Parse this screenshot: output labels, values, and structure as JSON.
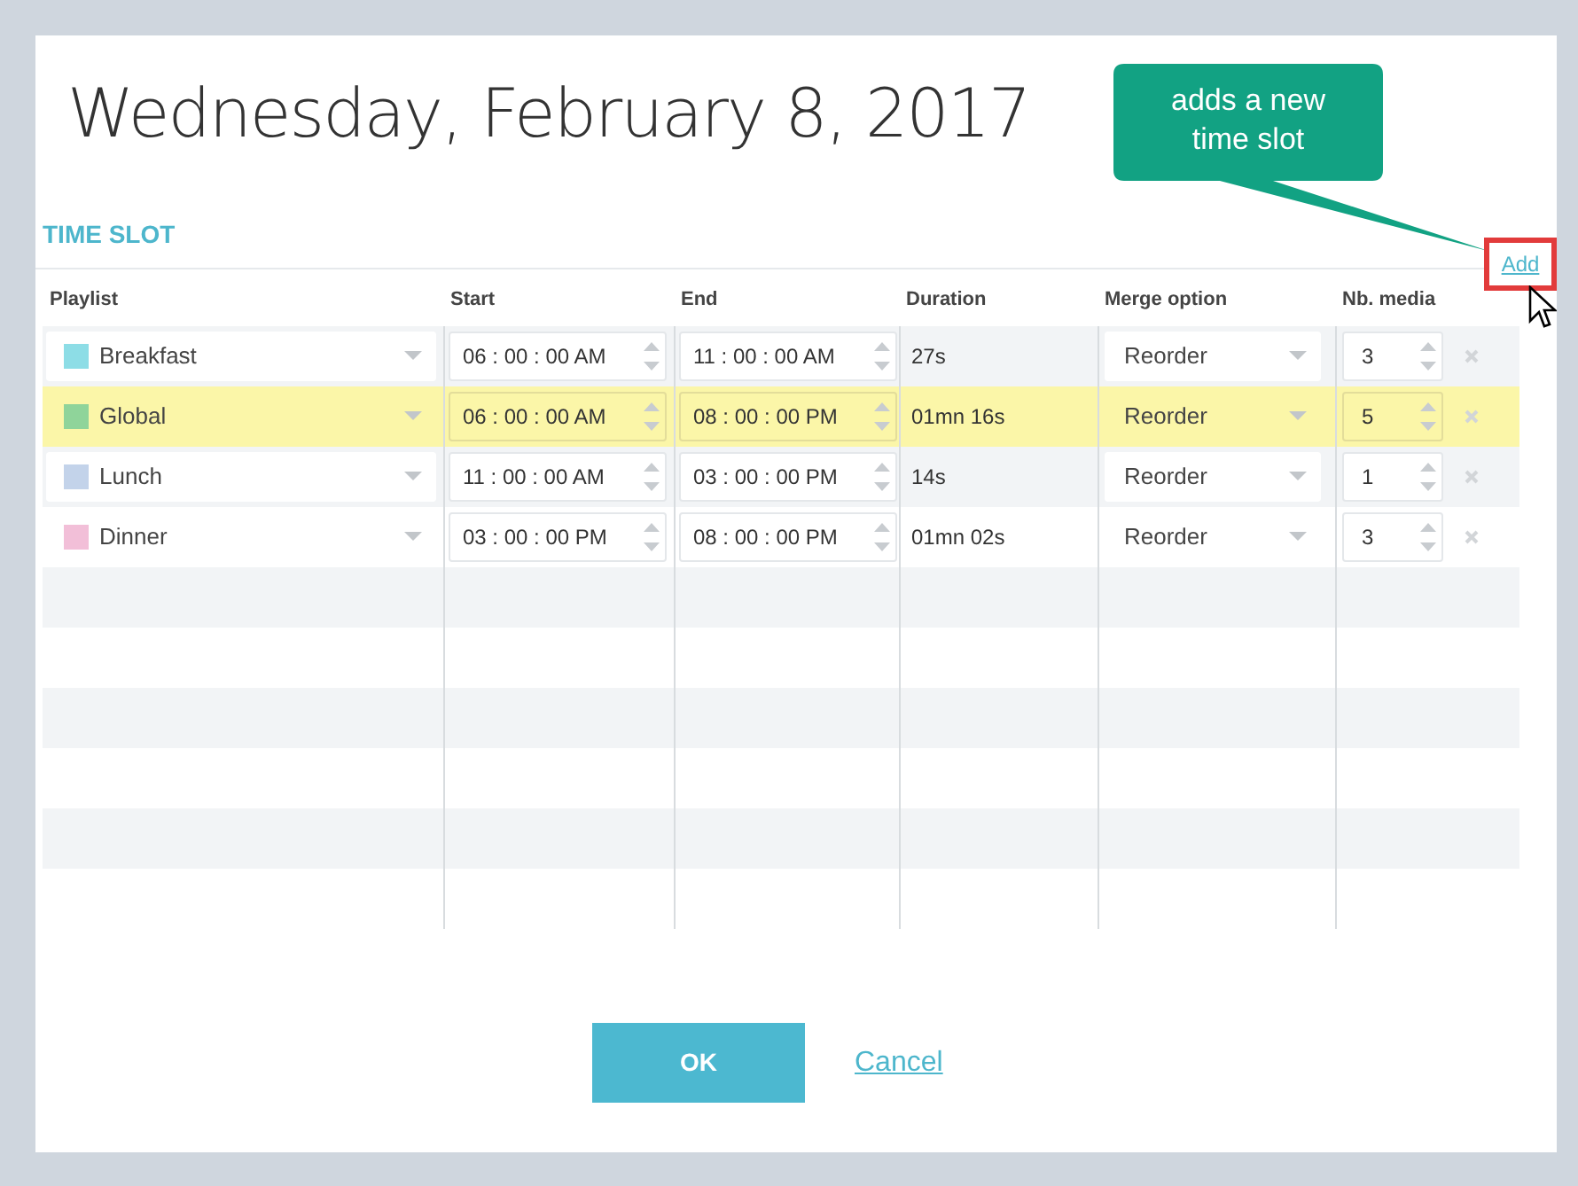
{
  "dialog": {
    "title": "Wednesday, February 8, 2017",
    "section_title": "TIME SLOT",
    "add_link": "Add",
    "callout": {
      "text": "adds a new time slot"
    },
    "table": {
      "columns": [
        "Playlist",
        "Start",
        "End",
        "Duration",
        "Merge option",
        "Nb. media"
      ],
      "rows": [
        {
          "playlist": "Breakfast",
          "color": "#8ddde6",
          "start": "06 : 00 : 00 AM",
          "end": "11 : 00 : 00 AM",
          "duration": "27s",
          "merge": "Reorder",
          "media": "3",
          "selected": false
        },
        {
          "playlist": "Global",
          "color": "#8fd49a",
          "start": "06 : 00 : 00 AM",
          "end": "08 : 00 : 00 PM",
          "duration": "01mn 16s",
          "merge": "Reorder",
          "media": "5",
          "selected": true
        },
        {
          "playlist": "Lunch",
          "color": "#c3d3ea",
          "start": "11 : 00 : 00 AM",
          "end": "03 : 00 : 00 PM",
          "duration": "14s",
          "merge": "Reorder",
          "media": "1",
          "selected": false
        },
        {
          "playlist": "Dinner",
          "color": "#f2bfd8",
          "start": "03 : 00 : 00 PM",
          "end": "08 : 00 : 00 PM",
          "duration": "01mn 02s",
          "merge": "Reorder",
          "media": "3",
          "selected": false
        }
      ]
    },
    "buttons": {
      "ok": "OK",
      "cancel": "Cancel"
    }
  }
}
